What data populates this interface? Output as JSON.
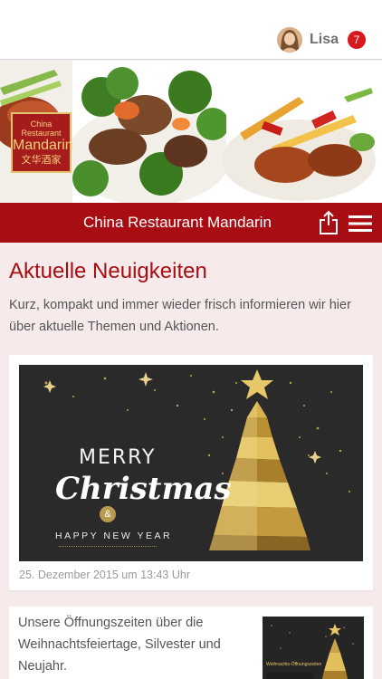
{
  "user": {
    "name": "Lisa",
    "notifications": "7"
  },
  "restaurant": {
    "name": "China Restaurant Mandarin",
    "logo": {
      "line1": "China Restaurant",
      "line2": "Mandarin",
      "line3": "文华酒家"
    }
  },
  "header": {
    "share_icon": "share-icon",
    "menu_icon": "hamburger-menu-icon"
  },
  "news": {
    "title": "Aktuelle Neuigkeiten",
    "intro": "Kurz, kompakt und immer wieder frisch informieren wir hier über aktuelle Themen und Aktionen.",
    "posts": [
      {
        "image_text": {
          "merry": "MERRY",
          "christmas": "Christmas",
          "amp": "&",
          "new_year": "HAPPY NEW YEAR"
        },
        "date": "25. Dezember 2015 um 13:43 Uhr"
      },
      {
        "text": "Unsere Öffnungszeiten über die Weihnachtsfeiertage, Silvester und Neujahr.",
        "thumb_label": "Weihnachts-Öffnungszeiten"
      }
    ]
  },
  "colors": {
    "brand_red": "#a80d13",
    "badge_red": "#d7181f",
    "background": "#f6eaea",
    "gold": "#c9a44c"
  }
}
